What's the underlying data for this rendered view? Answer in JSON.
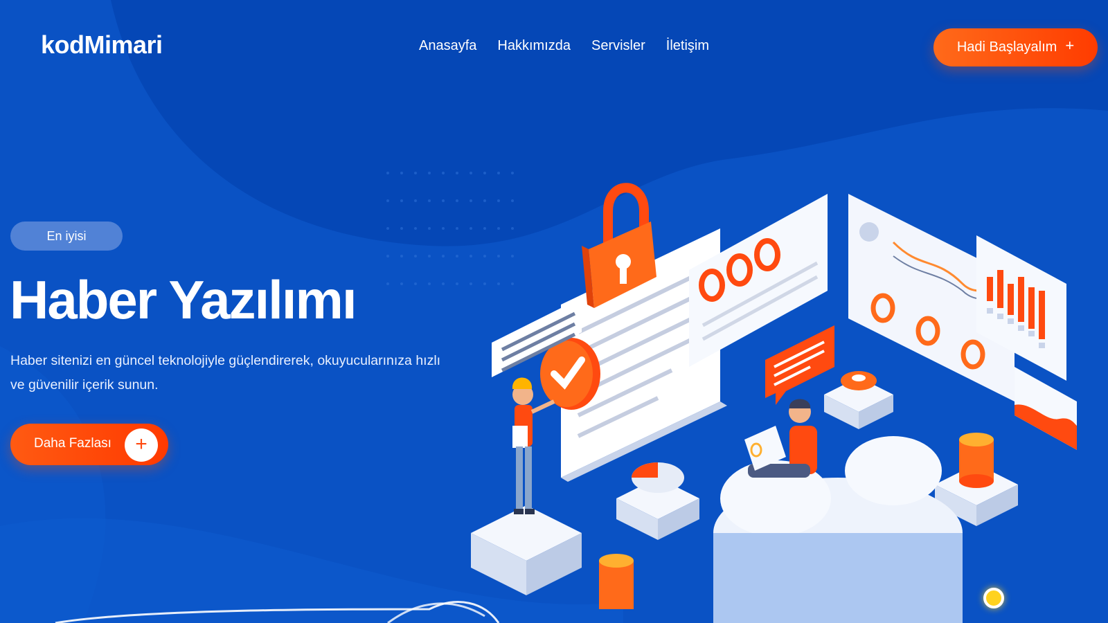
{
  "header": {
    "logo": "kodMimari",
    "nav": [
      "Anasayfa",
      "Hakkımızda",
      "Servisler",
      "İletişim"
    ],
    "cta_label": "Hadi Başlayalım",
    "cta_icon": "+"
  },
  "hero": {
    "badge": "En iyisi",
    "title": "Haber Yazılımı",
    "description": "Haber sitenizi en güncel teknolojiyle güçlendirerek, okuyucularınıza hızlı ve güvenilir içerik sunun.",
    "button_label": "Daha Fazlası",
    "button_icon": "+"
  },
  "colors": {
    "background": "#0a52c4",
    "accent": "#ff4a10",
    "slider_active": "#ffd21f"
  },
  "icons": [
    "lock-icon",
    "check-icon",
    "gear-icon",
    "plus-icon"
  ]
}
